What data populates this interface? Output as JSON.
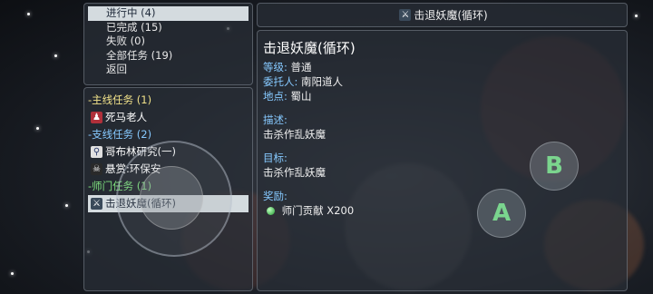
{
  "filter_menu": {
    "items": [
      {
        "label": "进行中 (4)",
        "selected": true
      },
      {
        "label": "已完成 (15)",
        "selected": false
      },
      {
        "label": "失败 (0)",
        "selected": false
      },
      {
        "label": "全部任务 (19)",
        "selected": false
      },
      {
        "label": "返回",
        "selected": false
      }
    ]
  },
  "quest_list": {
    "main_category": "-主线任务 (1)",
    "main_quest": "死马老人",
    "side_category": "-支线任务 (2)",
    "side_quest_1": "哥布林研究(一)",
    "side_quest_2": "悬赏:环保安",
    "master_category": "-师门任务 (1)",
    "master_quest": "击退妖魔(循环)"
  },
  "detail": {
    "header_title": "击退妖魔(循环)",
    "title": "击退妖魔(循环)",
    "level_label": "等级:",
    "level_value": "普通",
    "client_label": "委托人:",
    "client_value": "南阳道人",
    "location_label": "地点:",
    "location_value": "蜀山",
    "desc_label": "描述:",
    "desc_value": "击杀作乱妖魔",
    "target_label": "目标:",
    "target_value": "击杀作乱妖魔",
    "reward_label": "奖励:",
    "reward_value": "师门贡献 X200"
  },
  "controls": {
    "b_label": "B",
    "a_label": "A"
  }
}
